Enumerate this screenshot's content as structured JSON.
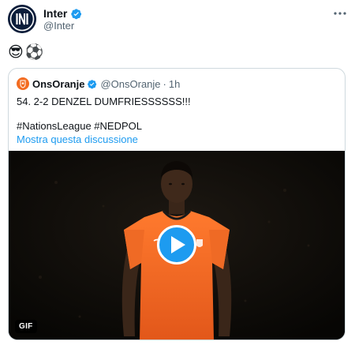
{
  "author": {
    "name": "Inter",
    "handle": "@Inter",
    "verified": true,
    "avatar_icon": "inter-logo-icon"
  },
  "tweet": {
    "emojis": [
      "😎",
      "⚽"
    ]
  },
  "quoted_tweet": {
    "author_name": "OnsOranje",
    "author_handle": "@OnsOranje",
    "separator": "·",
    "time": "1h",
    "verified": true,
    "avatar_icon": "knvb-lion-icon",
    "text": "54. 2-2 DENZEL DUMFRIESSSSSS!!!",
    "hashtags": "#NationsLeague #NEDPOL",
    "show_thread_label": "Mostra questa discussione",
    "media": {
      "type": "GIF",
      "badge": "GIF",
      "play_icon": "play-icon"
    }
  },
  "colors": {
    "accent": "#1d9bf0",
    "secondary_text": "#536471",
    "border": "#cfd9de",
    "jersey": "#f36c21"
  }
}
